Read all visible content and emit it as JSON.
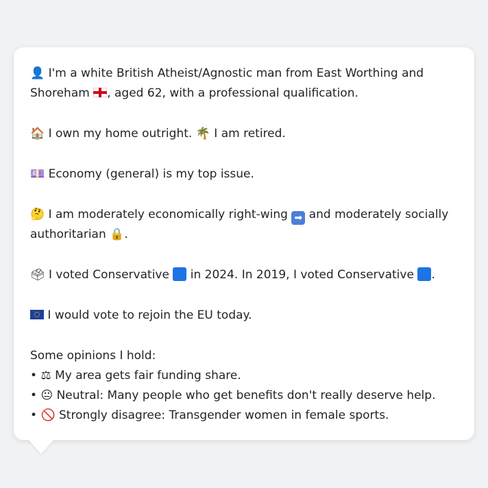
{
  "persona": {
    "identity": {
      "icon": "person-silhouette-icon",
      "text_a": "I'm a white British Atheist/Agnostic man from East Worthing and Shoreham",
      "flag": "england-flag-icon",
      "text_b": ", aged 62, with a professional qualification."
    },
    "housing": {
      "icon_home": "house-icon",
      "text_a": "I own my home outright.",
      "icon_palm": "palm-tree-icon",
      "text_b": "I am retired."
    },
    "issue": {
      "icon": "banknote-icon",
      "text": "Economy (general) is my top issue."
    },
    "ideology": {
      "icon": "thinking-face-icon",
      "text_a": "I am moderately economically right-wing",
      "icon_arrow": "right-arrow-icon",
      "text_b": "and moderately socially authoritarian",
      "icon_lock": "lock-icon",
      "text_c": "."
    },
    "votes": {
      "icon": "ballot-box-icon",
      "text_a": "I voted Conservative",
      "party_color": "#1d74e3",
      "text_b": "in 2024. In 2019, I voted Conservative",
      "text_c": "."
    },
    "eu": {
      "icon": "eu-flag-icon",
      "text": "I would vote to rejoin the EU today."
    },
    "opinions": {
      "heading": "Some opinions I hold:",
      "items": [
        {
          "bullet": "•",
          "icon": "balance-scale-icon",
          "glyph": "⚖",
          "text": "My area gets fair funding share."
        },
        {
          "bullet": "•",
          "icon": "neutral-face-icon",
          "glyph": "😐",
          "text": "Neutral: Many people who get benefits don't really deserve help."
        },
        {
          "bullet": "•",
          "icon": "prohibited-icon",
          "glyph": "🚫",
          "text": "Strongly disagree: Transgender women in female sports."
        }
      ]
    }
  }
}
